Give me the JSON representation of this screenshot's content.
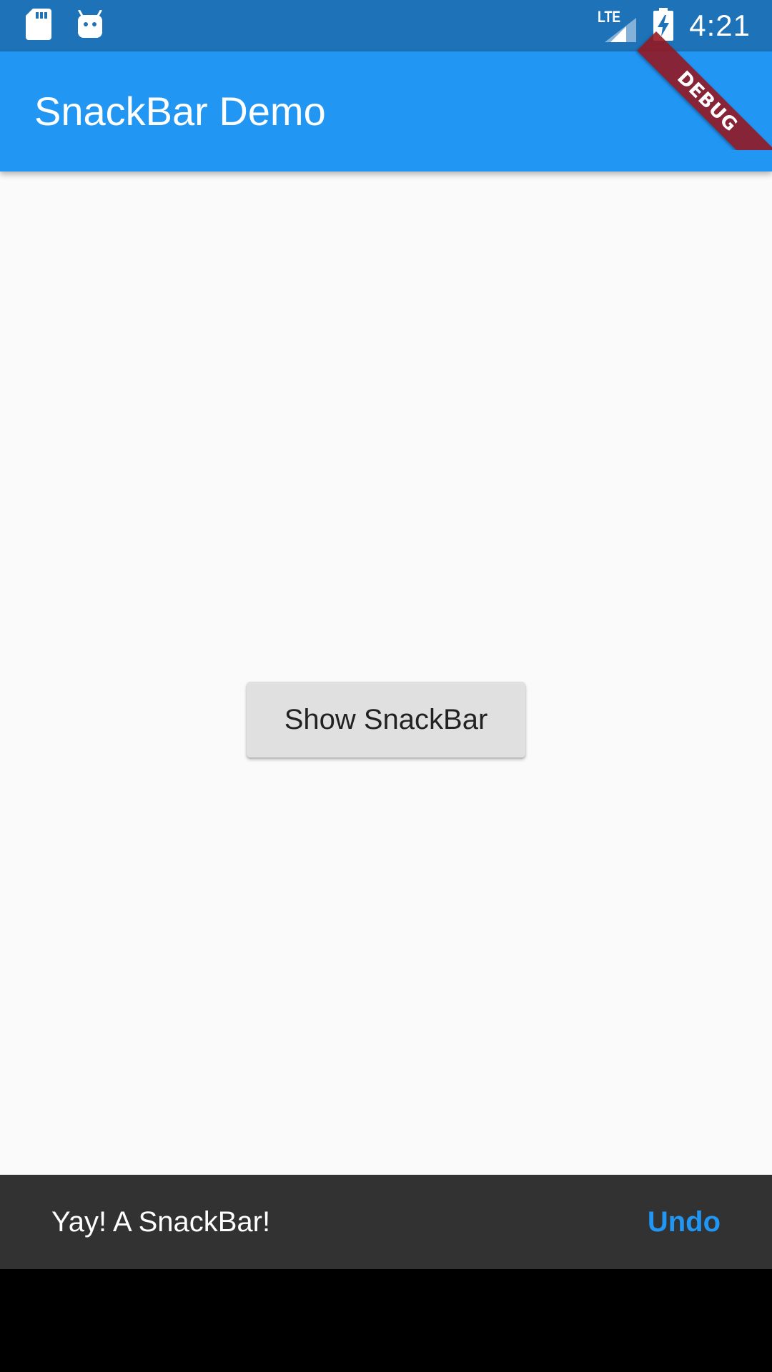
{
  "status_bar": {
    "time": "4:21",
    "network_label": "LTE",
    "icons": [
      "sd-card-icon",
      "android-icon",
      "lte-signal-icon",
      "battery-charging-icon"
    ],
    "background": "#1E72B8"
  },
  "app_bar": {
    "title": "SnackBar Demo",
    "background": "#2196F3"
  },
  "main": {
    "button_label": "Show SnackBar"
  },
  "snackbar": {
    "message": "Yay! A SnackBar!",
    "action_label": "Undo",
    "action_color": "#2196F3",
    "background": "#323232"
  },
  "debug_banner": {
    "label": "DEBUG"
  }
}
